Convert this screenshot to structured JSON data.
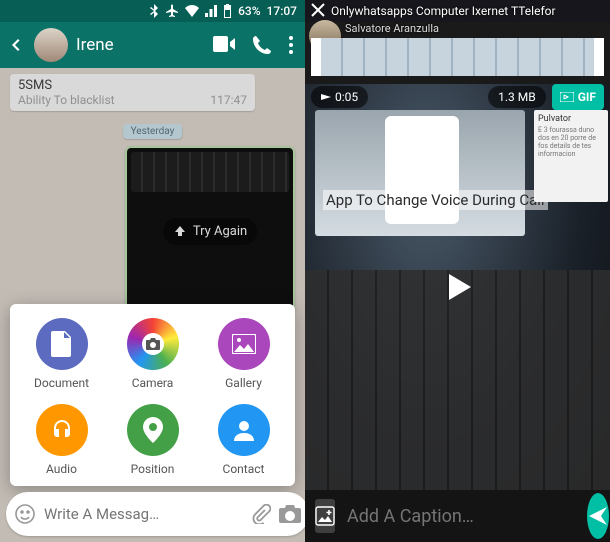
{
  "status": {
    "battery": "63%",
    "time": "17:07"
  },
  "chat": {
    "contact_name": "Irene",
    "msg_in_line1": "5SMS",
    "msg_in_line2": "Ability To blacklist",
    "msg_in_time": "117:47",
    "day_chip": "Yesterday",
    "retry_label": "Try Again",
    "input_placeholder": "Write A Messag…"
  },
  "attach": {
    "items": [
      {
        "label": "Document",
        "color": "#5c6bc0",
        "icon": "doc"
      },
      {
        "label": "Camera",
        "color": "#ec407a",
        "icon": "camera-wheel"
      },
      {
        "label": "Gallery",
        "color": "#ab47bc",
        "icon": "image"
      },
      {
        "label": "Audio",
        "color": "#ff9800",
        "icon": "headphones"
      },
      {
        "label": "Position",
        "color": "#43a047",
        "icon": "pin"
      },
      {
        "label": "Contact",
        "color": "#2196f3",
        "icon": "person"
      }
    ]
  },
  "editor": {
    "breadcrumb": "Onlywhatsapps Computer Ixernet TTelefor",
    "subtitle": "Salvatore Aranzulla",
    "duration": "0:05",
    "filesize": "1.3 MB",
    "gif_label": "GIF",
    "overlay_text": "App To Change Voice During Call",
    "side_title": "Pulvator",
    "caption_placeholder": "Add A Caption…"
  }
}
